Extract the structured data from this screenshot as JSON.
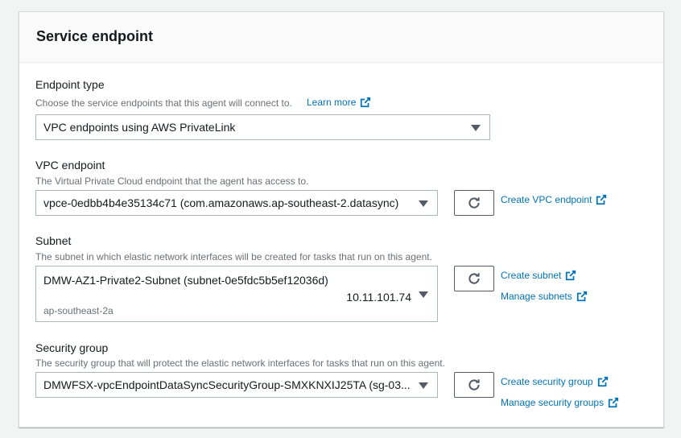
{
  "panel": {
    "title": "Service endpoint"
  },
  "endpoint_type": {
    "label": "Endpoint type",
    "description": "Choose the service endpoints that this agent will connect to.",
    "learn_more": "Learn more",
    "value": "VPC endpoints using AWS PrivateLink"
  },
  "vpc_endpoint": {
    "label": "VPC endpoint",
    "description": "The Virtual Private Cloud endpoint that the agent has access to.",
    "value": "vpce-0edbb4b4e35134c71 (com.amazonaws.ap-southeast-2.datasync)",
    "create_link": "Create VPC endpoint"
  },
  "subnet": {
    "label": "Subnet",
    "description": "The subnet in which elastic network interfaces will be created for tasks that run on this agent.",
    "value": "DMW-AZ1-Private2-Subnet (subnet-0e5fdc5b5ef12036d)",
    "ip": "10.11.101.74",
    "zone": "ap-southeast-2a",
    "create_link": "Create subnet",
    "manage_link": "Manage subnets"
  },
  "security_group": {
    "label": "Security group",
    "description": "The security group that will protect the elastic network interfaces for tasks that run on this agent.",
    "value": "DMWFSX-vpcEndpointDataSyncSecurityGroup-SMXKNXIJ25TA (sg-03...",
    "create_link": "Create security group",
    "manage_link": "Manage security groups"
  },
  "colors": {
    "link": "#0073bb",
    "text": "#16191f",
    "muted": "#687078",
    "border": "#aab7b8"
  },
  "icons": {
    "refresh": "refresh-icon",
    "external": "external-link-icon",
    "caret": "caret-down-icon"
  }
}
